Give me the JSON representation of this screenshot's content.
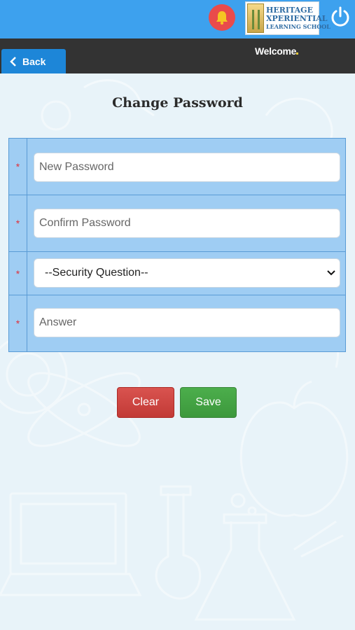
{
  "header": {
    "logo_line1": "HERITAGE",
    "logo_line2": "XPERIENTIAL",
    "logo_line3": "LEARNING SCHOOL"
  },
  "subbar": {
    "back_label": "Back",
    "welcome_text": "Welcome"
  },
  "page": {
    "title": "Change Password"
  },
  "form": {
    "new_password_placeholder": "New Password",
    "confirm_password_placeholder": "Confirm Password",
    "security_question_selected": "--Security Question--",
    "answer_placeholder": "Answer",
    "required_marker": "*"
  },
  "actions": {
    "clear_label": "Clear",
    "save_label": "Save"
  },
  "colors": {
    "header_blue": "#3da1ee",
    "subbar_dark": "#333333",
    "back_blue": "#1d86d8",
    "table_blue": "#9fcdf3",
    "clear_red": "#d9534f",
    "save_green": "#4cae4c",
    "required_red": "#e0303a"
  }
}
